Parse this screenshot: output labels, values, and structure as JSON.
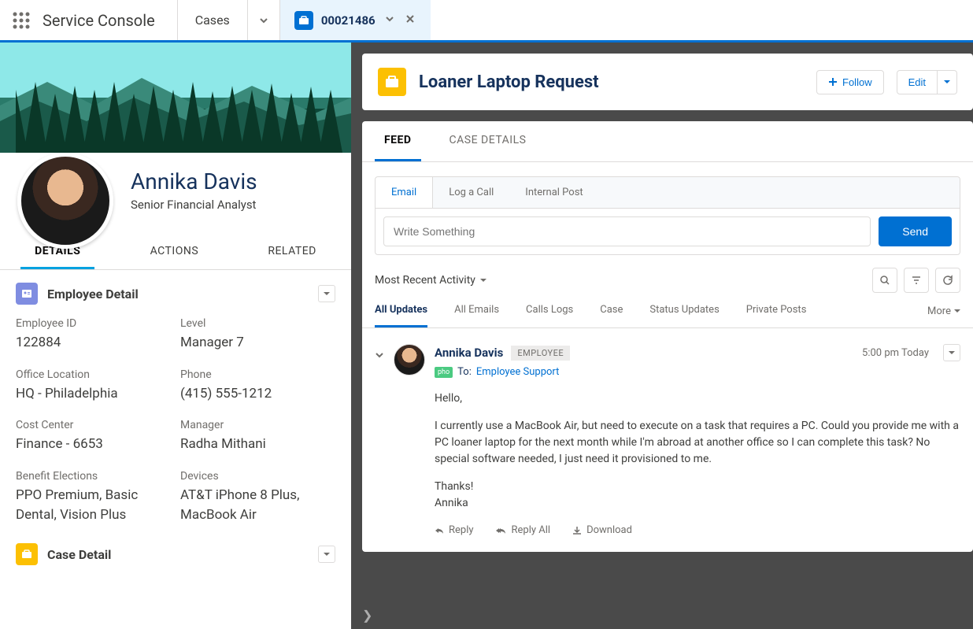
{
  "nav": {
    "app_title": "Service Console",
    "item_cases": "Cases",
    "tab_number": "00021486"
  },
  "person": {
    "name": "Annika Davis",
    "role": "Senior Financial Analyst"
  },
  "left_tabs": {
    "details": "DETAILS",
    "actions": "ACTIONS",
    "related": "RELATED"
  },
  "emp_detail": {
    "title": "Employee Detail",
    "employee_id_lbl": "Employee ID",
    "employee_id_val": "122884",
    "level_lbl": "Level",
    "level_val": "Manager 7",
    "office_lbl": "Office Location",
    "office_val": "HQ - Philadelphia",
    "phone_lbl": "Phone",
    "phone_val": "(415) 555-1212",
    "cost_center_lbl": "Cost Center",
    "cost_center_val": "Finance - 6653",
    "manager_lbl": "Manager",
    "manager_val": "Radha Mithani",
    "benefits_lbl": "Benefit Elections",
    "benefits_val": "PPO Premium, Basic Dental, Vision Plus",
    "devices_lbl": "Devices",
    "devices_val": "AT&T iPhone 8 Plus, MacBook Air"
  },
  "case_detail": {
    "title": "Case Detail"
  },
  "case_header": {
    "title": "Loaner Laptop Request",
    "follow": "Follow",
    "edit": "Edit"
  },
  "feed_tabs": {
    "feed": "FEED",
    "case_details": "CASE DETAILS"
  },
  "composer": {
    "email": "Email",
    "log_call": "Log a Call",
    "internal_post": "Internal Post",
    "placeholder": "Write Something",
    "send": "Send"
  },
  "feed_ctrl": {
    "sort": "Most Recent Activity"
  },
  "filters": {
    "all_updates": "All Updates",
    "all_emails": "All Emails",
    "calls_logs": "Calls Logs",
    "case": "Case",
    "status_updates": "Status Updates",
    "private_posts": "Private Posts",
    "more": "More"
  },
  "post": {
    "author": "Annika Davis",
    "badge": "EMPLOYEE",
    "time": "5:00 pm Today",
    "to_label": "To:",
    "to_link": "Employee Support",
    "pho": "pho",
    "greeting": "Hello,",
    "body": "I currently use a MacBook Air, but need to execute on a task that requires a PC.  Could you provide me with a PC loaner laptop for the next month while I'm abroad at another office so I can complete this task? No special software needed, I just need it provisioned to me.",
    "thanks": "Thanks!",
    "sign": "Annika",
    "reply": "Reply",
    "reply_all": "Reply All",
    "download": "Download"
  }
}
